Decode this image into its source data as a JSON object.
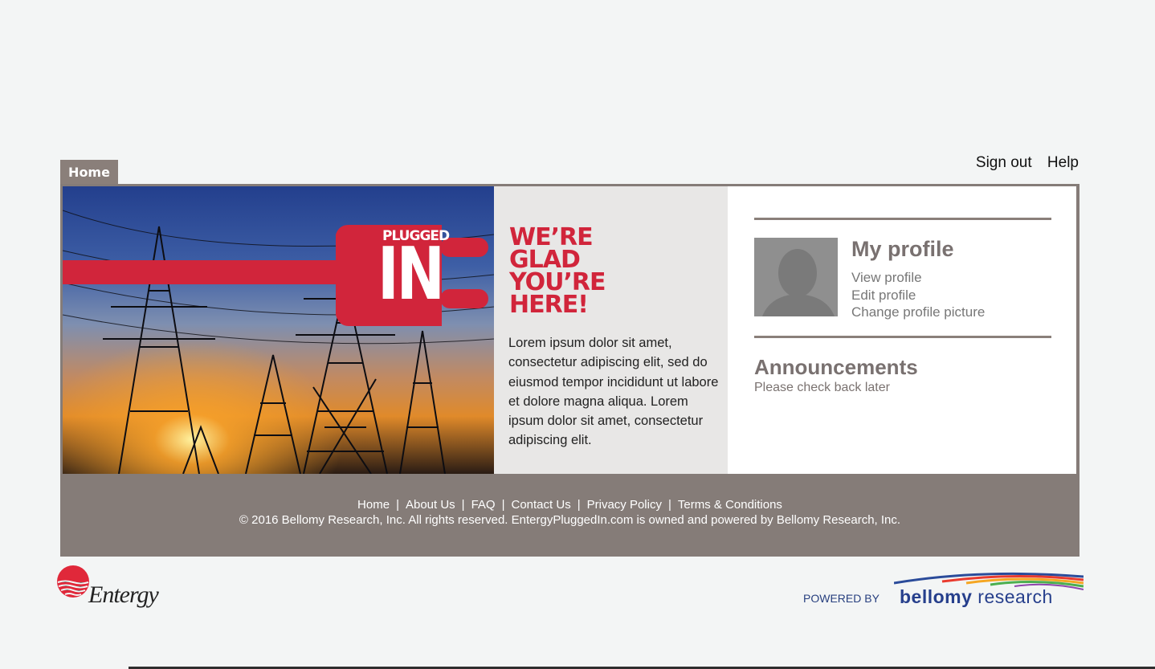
{
  "nav": {
    "home_tab": "Home",
    "sign_out": "Sign out",
    "help": "Help"
  },
  "hero": {
    "plug_text_top": "PLUGGED",
    "plug_text_big": "IN"
  },
  "welcome": {
    "headline": "WE’RE\nGLAD\nYOU’RE\nHERE!",
    "body": "Lorem ipsum dolor sit amet, consectetur adipiscing elit, sed do eiusmod tempor incididunt ut labore et dolore magna aliqua. Lorem ipsum dolor sit amet, consectetur adipiscing elit."
  },
  "profile": {
    "title": "My profile",
    "links": [
      "View profile",
      "Edit profile",
      "Change profile picture"
    ]
  },
  "announcements": {
    "title": "Announcements",
    "text": "Please check back later"
  },
  "footer": {
    "links": [
      "Home",
      "About Us",
      "FAQ",
      "Contact Us",
      "Privacy Policy",
      "Terms & Conditions"
    ],
    "separator": "|",
    "copyright": "© 2016 Bellomy Research, Inc. All rights reserved. EntergyPluggedIn.com is owned and powered by Bellomy Research, Inc."
  },
  "branding": {
    "entergy": "Entergy",
    "powered_by": "POWERED BY",
    "bellomy_bold": "bellomy",
    "bellomy_light": " research"
  },
  "colors": {
    "brand_red": "#d1253b",
    "frame_taupe": "#857c78",
    "bellomy_blue": "#263f8c"
  }
}
